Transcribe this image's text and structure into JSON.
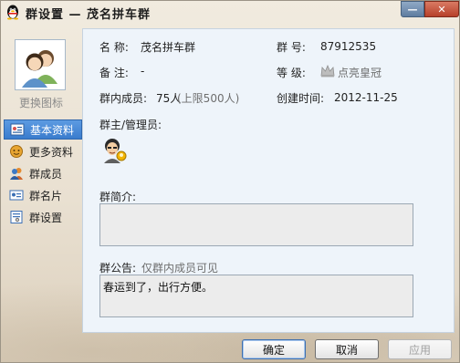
{
  "window": {
    "title": "群设置 — 茂名拼车群",
    "minimize_glyph": "—",
    "close_glyph": "✕"
  },
  "sidebar": {
    "change_icon_label": "更换图标",
    "items": [
      {
        "label": "基本资料",
        "icon": "profile-card-icon",
        "active": true
      },
      {
        "label": "更多资料",
        "icon": "more-info-icon",
        "active": false
      },
      {
        "label": "群成员",
        "icon": "members-icon",
        "active": false
      },
      {
        "label": "群名片",
        "icon": "namecard-icon",
        "active": false
      },
      {
        "label": "群设置",
        "icon": "settings-icon",
        "active": false
      }
    ]
  },
  "info": {
    "name_label": "名  称:",
    "name_value": "茂名拼车群",
    "number_label": "群  号:",
    "number_value": "87912535",
    "remark_label": "备  注:",
    "remark_value": "-",
    "level_label": "等  级:",
    "level_value": "点亮皇冠",
    "members_label": "群内成员:",
    "members_value": "75人",
    "members_limit": "(上限500人)",
    "created_label": "创建时间:",
    "created_value": "2012-11-25",
    "admins_label": "群主/管理员:",
    "intro_label": "群简介:",
    "intro_value": "",
    "notice_label": "群公告:",
    "notice_hint": "仅群内成员可见",
    "notice_value": "春运到了，出行方便。"
  },
  "buttons": {
    "ok": "确定",
    "cancel": "取消",
    "apply": "应用"
  }
}
